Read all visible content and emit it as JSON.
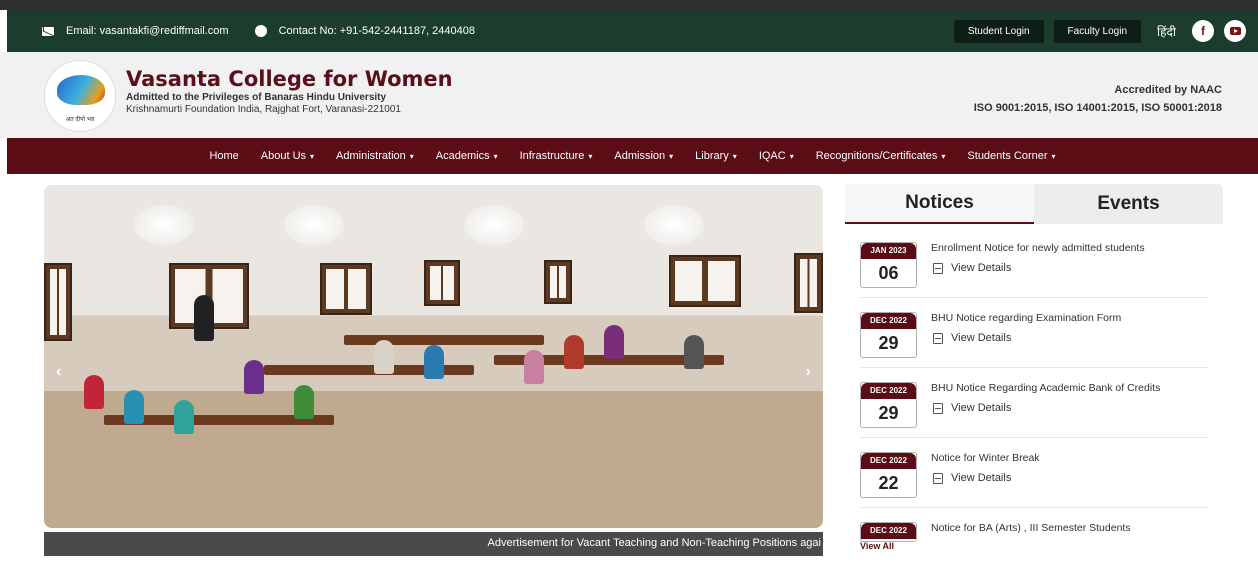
{
  "topbar": {
    "email": "Email: vasantakfi@rediffmail.com",
    "contact": "Contact No: +91-542-2441187, 2440408",
    "student_login": "Student Login",
    "faculty_login": "Faculty Login",
    "hindi": "हिंदी",
    "facebook_glyph": "f",
    "icons": [
      "mail-icon",
      "phone-icon",
      "facebook-icon",
      "youtube-icon"
    ]
  },
  "header": {
    "college_name": "Vasanta College for Women",
    "subtitle": "Admitted to the Privileges of Banaras Hindu University",
    "address": "Krishnamurti Foundation India, Rajghat Fort, Varanasi-221001",
    "logo_caption": "अत दीपो भव",
    "accreditation": "Accredited by NAAC",
    "iso": "ISO 9001:2015, ISO 14001:2015, ISO 50001:2018"
  },
  "nav": {
    "items": [
      {
        "label": "Home",
        "dropdown": false
      },
      {
        "label": "About Us",
        "dropdown": true
      },
      {
        "label": "Administration",
        "dropdown": true
      },
      {
        "label": "Academics",
        "dropdown": true
      },
      {
        "label": "Infrastructure",
        "dropdown": true
      },
      {
        "label": "Admission",
        "dropdown": true
      },
      {
        "label": "Library",
        "dropdown": true
      },
      {
        "label": "IQAC",
        "dropdown": true
      },
      {
        "label": "Recognitions/Certificates",
        "dropdown": true
      },
      {
        "label": "Students Corner",
        "dropdown": true
      }
    ],
    "caret": "▾"
  },
  "slider": {
    "prev": "‹",
    "next": "›",
    "ticker": "Advertisement for Vacant Teaching and Non-Teaching Positions agai"
  },
  "panel": {
    "tab_notices": "Notices",
    "tab_events": "Events",
    "view_all": "View All",
    "notices": [
      {
        "month": "JAN 2023",
        "day": "06",
        "title": "Enrollment Notice for newly admitted students",
        "link": "View Details"
      },
      {
        "month": "DEC 2022",
        "day": "29",
        "title": "BHU Notice regarding Examination Form",
        "link": "View Details"
      },
      {
        "month": "DEC 2022",
        "day": "29",
        "title": "BHU Notice Regarding Academic Bank of Credits",
        "link": "View Details"
      },
      {
        "month": "DEC 2022",
        "day": "22",
        "title": "Notice for Winter Break",
        "link": "View Details"
      },
      {
        "month": "DEC 2022",
        "day": "",
        "title": "Notice for BA (Arts) , III Semester Students",
        "link": ""
      }
    ]
  },
  "colors": {
    "topbar": "#1c3d2d",
    "nav": "#5a0d14",
    "brand_maroon": "#5a0f1c"
  }
}
